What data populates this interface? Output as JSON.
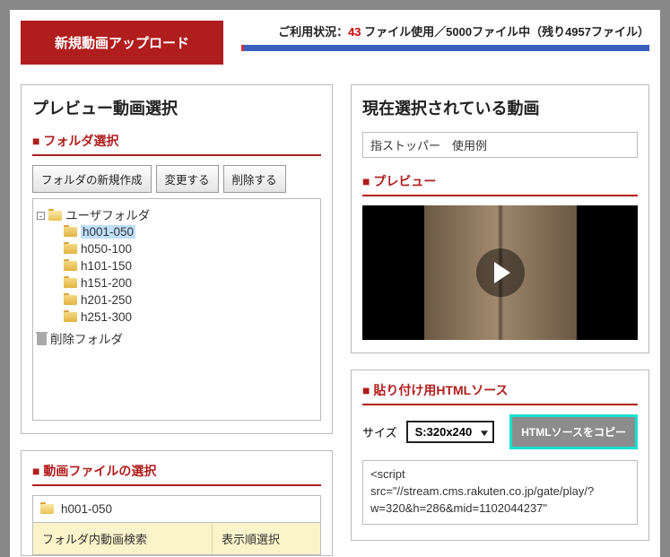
{
  "topbar": {
    "upload_label": "新規動画アップロード",
    "usage_prefix": "ご利用状況：",
    "usage_count": "43",
    "usage_mid": " ファイル使用／5000ファイル中（残り4957ファイル）",
    "usage_pct": 1
  },
  "left": {
    "panel_title": "プレビュー動画選択",
    "folder_head": "フォルダ選択",
    "btn_new": "フォルダの新規作成",
    "btn_edit": "変更する",
    "btn_delete": "削除する",
    "tree": {
      "root": "ユーザフォルダ",
      "trash": "削除フォルダ",
      "items": [
        {
          "label": "h001-050",
          "selected": true
        },
        {
          "label": "h050-100"
        },
        {
          "label": "h101-150"
        },
        {
          "label": "h151-200"
        },
        {
          "label": "h201-250"
        },
        {
          "label": "h251-300"
        }
      ]
    },
    "files_head": "動画ファイルの選択",
    "current_folder": "h001-050",
    "search_label": "フォルダ内動画検索",
    "sort_label": "表示順選択"
  },
  "right": {
    "panel_title": "現在選択されている動画",
    "video_title": "指ストッパー　使用例",
    "preview_head": "プレビュー",
    "html_head": "貼り付け用HTMLソース",
    "size_label": "サイズ",
    "size_value": "S:320x240",
    "copy_label": "HTMLソースをコピー",
    "code": "<script src=\"//stream.cms.rakuten.co.jp/gate/play/?w=320&h=286&mid=1102044237\""
  }
}
